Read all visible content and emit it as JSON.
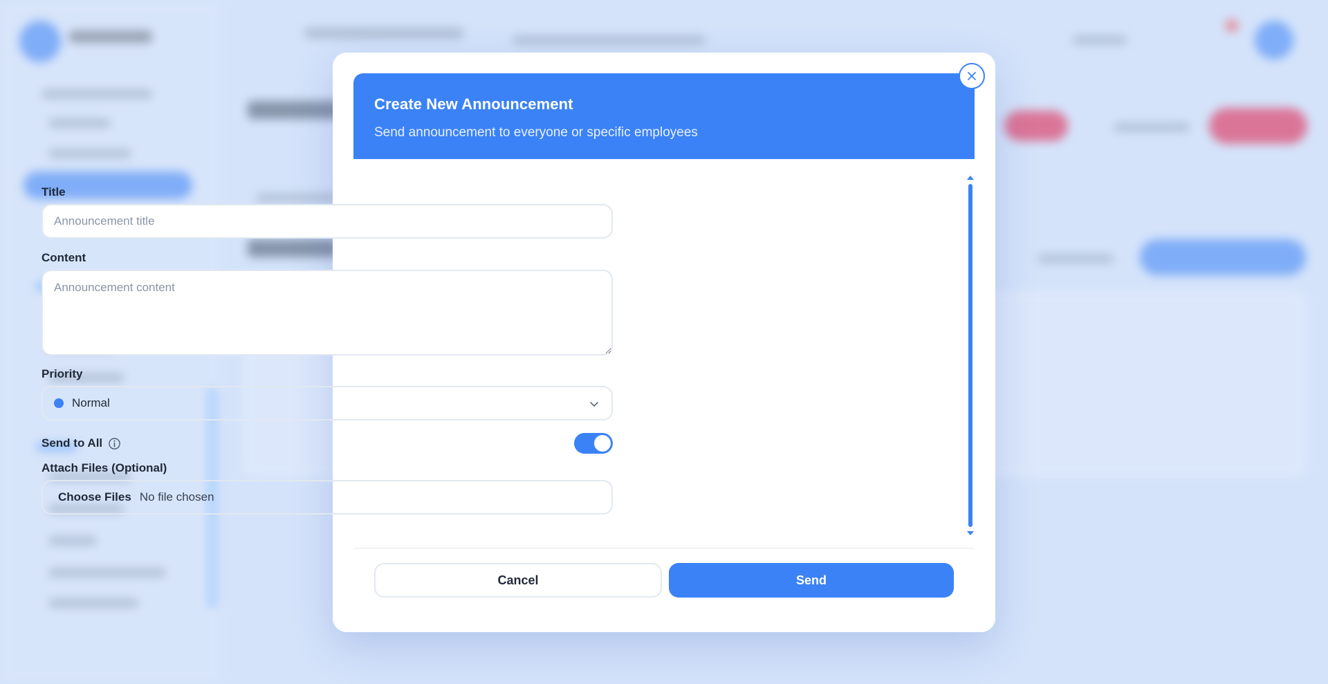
{
  "theme": {
    "accent": "#3b82f6",
    "priority_dot": "#3b82f6",
    "toggle_on": "#3b82f6"
  },
  "modal": {
    "title": "Create New Announcement",
    "subtitle": "Send announcement to everyone or specific employees",
    "close_icon": "close-icon",
    "fields": {
      "title": {
        "label": "Title",
        "placeholder": "Announcement title",
        "value": ""
      },
      "content": {
        "label": "Content",
        "placeholder": "Announcement content",
        "value": ""
      },
      "priority": {
        "label": "Priority",
        "selected": "Normal"
      },
      "send_to_all": {
        "label": "Send to All",
        "enabled": true,
        "info_icon": "info-icon"
      },
      "attachments": {
        "label": "Attach Files (Optional)",
        "button_label": "Choose Files",
        "status": "No file chosen"
      }
    },
    "actions": {
      "cancel_label": "Cancel",
      "send_label": "Send"
    }
  }
}
